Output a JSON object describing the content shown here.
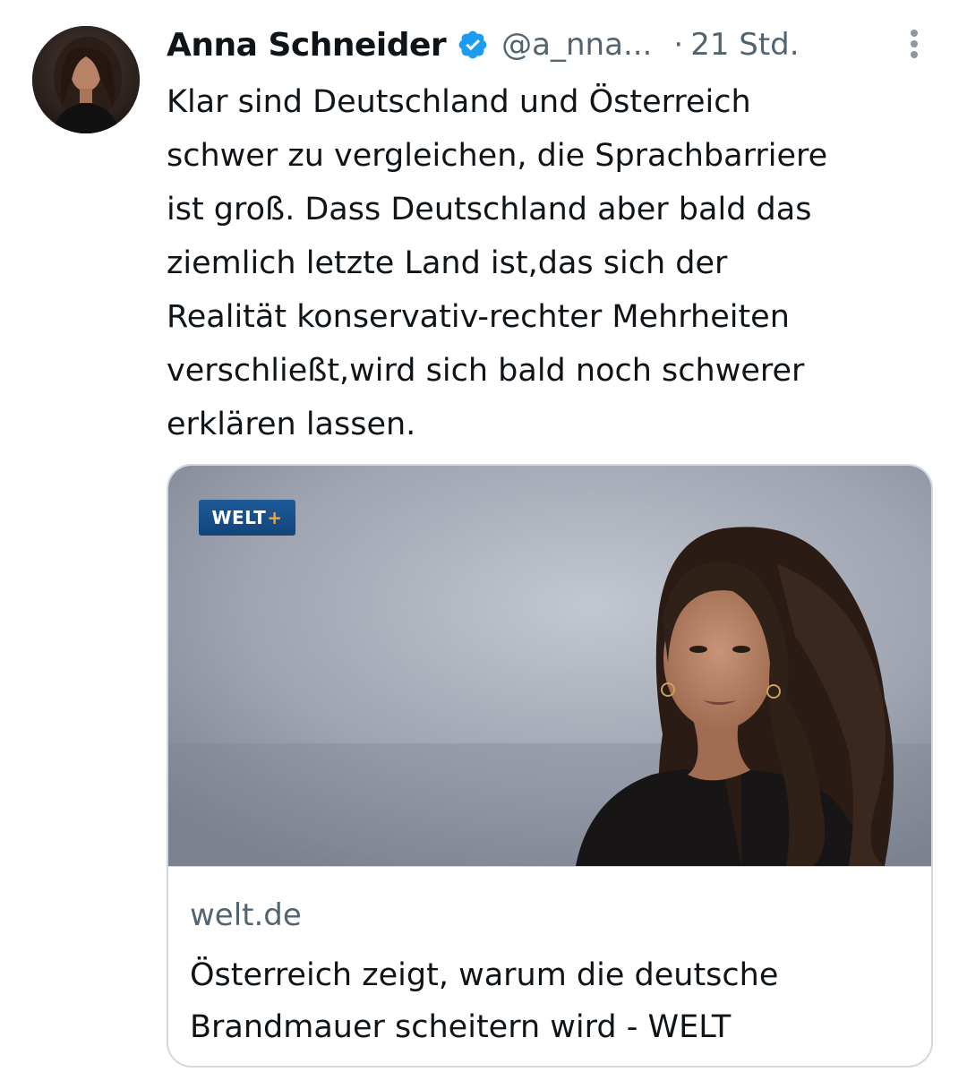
{
  "tweet": {
    "author": {
      "name": "Anna Schneider",
      "handle": "@a_nna...",
      "verified": true,
      "verified_color": "#1d9bf0",
      "avatar_icon": "profile-photo"
    },
    "separator": "·",
    "time": "21 Std.",
    "more_icon": "more-vertical-icon",
    "text_lines": [
      "Klar sind Deutschland und Österreich",
      "schwer zu vergleichen, die Sprachbarriere",
      "ist groß. Dass Deutschland aber bald das",
      "ziemlich letzte Land ist,das sich der",
      "Realität konservativ-rechter Mehrheiten",
      "verschließt,wird sich bald noch schwerer",
      "erklären lassen."
    ],
    "link_card": {
      "badge": {
        "text": "WELT",
        "plus": "+",
        "bg_color": "#134479",
        "plus_color": "#f7a823"
      },
      "domain": "welt.de",
      "title_lines": [
        "Österreich zeigt, warum die deutsche",
        "Brandmauer scheitern wird - WELT"
      ]
    }
  }
}
